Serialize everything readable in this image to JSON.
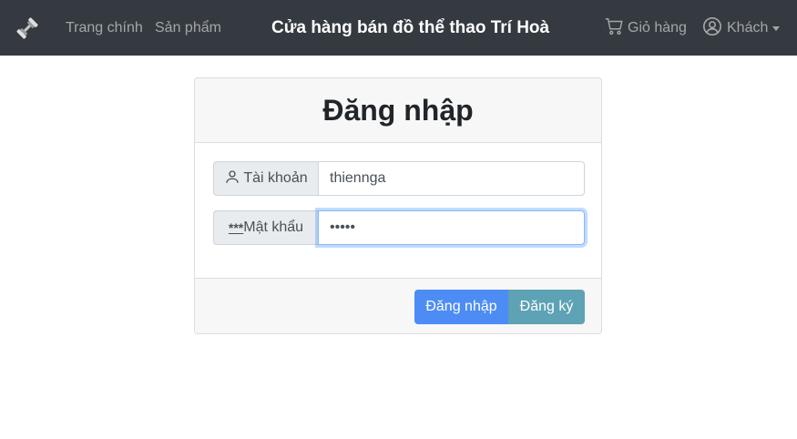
{
  "navbar": {
    "logo_icon": "dumbbell-icon",
    "home_label": "Trang chính",
    "products_label": "Sản phẩm",
    "site_title": "Cửa hàng bán đồ thể thao Trí Hoà",
    "cart_icon": "cart-icon",
    "cart_label": "Giỏ hàng",
    "user_icon": "user-circle-icon",
    "user_label": "Khách"
  },
  "login_form": {
    "title": "Đăng nhập",
    "username": {
      "icon": "person-icon",
      "label": "Tài khoản",
      "value": "thiennga"
    },
    "password": {
      "icon_text": "***",
      "label": "Mật khẩu",
      "value": "•••••"
    },
    "login_button": "Đăng nhập",
    "register_button": "Đăng ký"
  },
  "colors": {
    "navbar_bg": "#343a40",
    "primary": "#4d8cf5",
    "info": "#5ea2b5"
  }
}
